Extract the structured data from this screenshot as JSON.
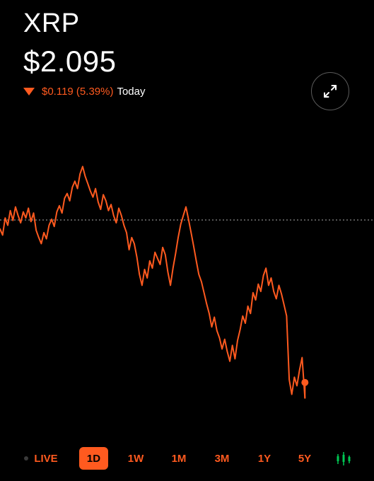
{
  "header": {
    "ticker": "XRP",
    "price": "$2.095",
    "change_value": "$0.119 (5.39%)",
    "change_period": "Today",
    "change_direction": "down"
  },
  "icons": {
    "expand": "expand-arrows-icon",
    "change_arrow": "triangle-down-icon",
    "chart_style": "candlestick-icon"
  },
  "colors": {
    "accent": "#ff5a1f",
    "background": "#000000",
    "text": "#ffffff",
    "reference_line": "#8a8a8a"
  },
  "ranges": {
    "items": [
      "LIVE",
      "1D",
      "1W",
      "1M",
      "3M",
      "1Y",
      "5Y"
    ],
    "selected": "1D"
  },
  "chart_data": {
    "type": "line",
    "reference_line": "dotted",
    "series": [
      {
        "values": [
          2.233,
          2.228,
          2.242,
          2.236,
          2.248,
          2.24,
          2.251,
          2.244,
          2.238,
          2.247,
          2.242,
          2.25,
          2.239,
          2.246,
          2.232,
          2.226,
          2.221,
          2.23,
          2.225,
          2.236,
          2.241,
          2.235,
          2.247,
          2.252,
          2.246,
          2.258,
          2.262,
          2.256,
          2.267,
          2.272,
          2.266,
          2.278,
          2.284,
          2.276,
          2.27,
          2.264,
          2.259,
          2.266,
          2.255,
          2.249,
          2.261,
          2.256,
          2.248,
          2.253,
          2.244,
          2.238,
          2.25,
          2.244,
          2.236,
          2.23,
          2.216,
          2.226,
          2.221,
          2.21,
          2.196,
          2.187,
          2.2,
          2.193,
          2.207,
          2.201,
          2.214,
          2.209,
          2.204,
          2.218,
          2.212,
          2.198,
          2.187,
          2.201,
          2.213,
          2.226,
          2.237,
          2.244,
          2.251,
          2.241,
          2.23,
          2.219,
          2.207,
          2.196,
          2.19,
          2.181,
          2.172,
          2.164,
          2.153,
          2.161,
          2.15,
          2.144,
          2.135,
          2.143,
          2.133,
          2.125,
          2.138,
          2.127,
          2.142,
          2.151,
          2.162,
          2.156,
          2.17,
          2.164,
          2.181,
          2.175,
          2.188,
          2.182,
          2.195,
          2.201,
          2.187,
          2.193,
          2.182,
          2.176,
          2.187,
          2.18,
          2.171,
          2.162,
          2.11,
          2.098,
          2.112,
          2.105,
          2.118,
          2.128
        ]
      }
    ],
    "current_value": 2.095
  }
}
